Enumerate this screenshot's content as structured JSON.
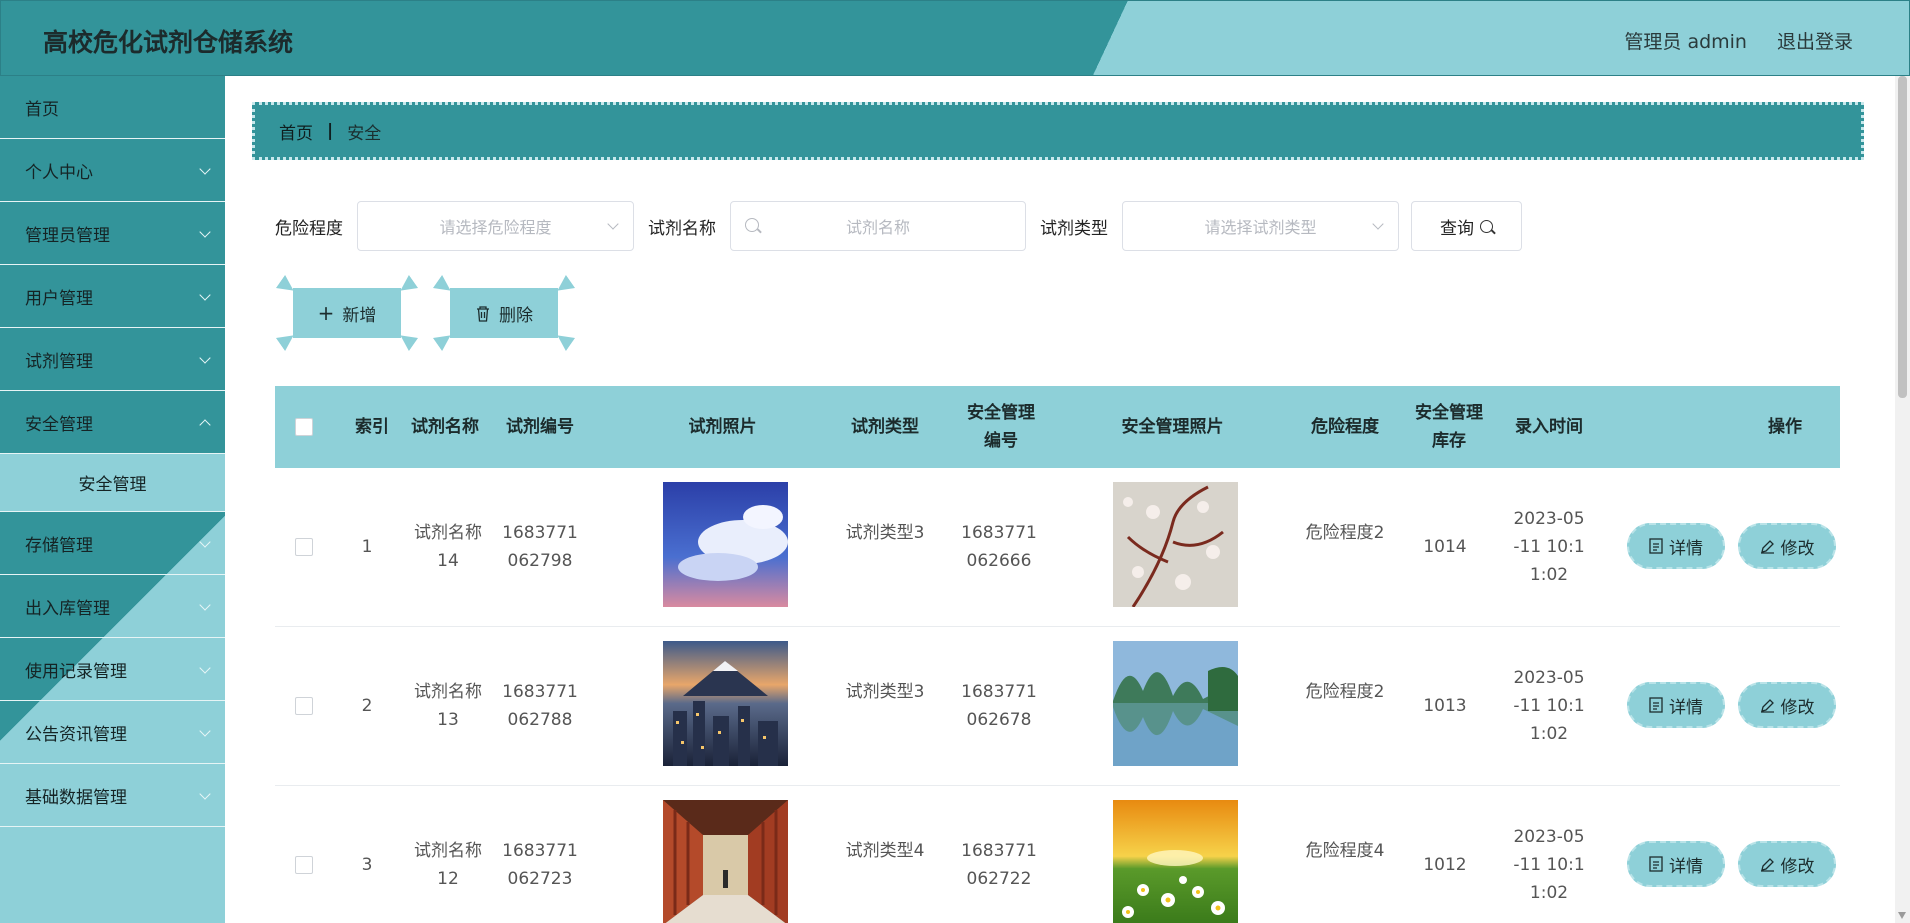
{
  "header": {
    "title": "高校危化试剂仓储系统",
    "user_label": "管理员 admin",
    "logout_label": "退出登录"
  },
  "sidebar": {
    "items": [
      {
        "label": "首页",
        "expandable": false
      },
      {
        "label": "个人中心",
        "expandable": true
      },
      {
        "label": "管理员管理",
        "expandable": true
      },
      {
        "label": "用户管理",
        "expandable": true
      },
      {
        "label": "试剂管理",
        "expandable": true
      },
      {
        "label": "安全管理",
        "expandable": true,
        "open": true,
        "children": [
          "安全管理"
        ]
      },
      {
        "label": "存储管理",
        "expandable": true
      },
      {
        "label": "出入库管理",
        "expandable": true
      },
      {
        "label": "使用记录管理",
        "expandable": true
      },
      {
        "label": "公告资讯管理",
        "expandable": true
      },
      {
        "label": "基础数据管理",
        "expandable": true
      }
    ]
  },
  "breadcrumb": {
    "home": "首页",
    "current": "安全"
  },
  "filters": {
    "danger_label": "危险程度",
    "danger_placeholder": "请选择危险程度",
    "name_label": "试剂名称",
    "name_placeholder": "试剂名称",
    "type_label": "试剂类型",
    "type_placeholder": "请选择试剂类型",
    "query_label": "查询"
  },
  "actions": {
    "add_label": "新增",
    "delete_label": "删除"
  },
  "table": {
    "headers": {
      "index": "索引",
      "name": "试剂名称",
      "code": "试剂编号",
      "photo": "试剂照片",
      "type": "试剂类型",
      "safety_code": "安全管理编号",
      "safety_photo": "安全管理照片",
      "danger": "危险程度",
      "stock": "安全管理库存",
      "time": "录入时间",
      "ops": "操作"
    },
    "row_actions": {
      "detail": "详情",
      "edit": "修改"
    },
    "rows": [
      {
        "index": "1",
        "name": "试剂名称14",
        "code": "1683771062798",
        "type": "试剂类型3",
        "safety_code": "1683771062666",
        "danger": "危险程度2",
        "stock": "1014",
        "time": "2023-05-11 10:11:02",
        "photo": "sky-clouds",
        "safety_photo": "blossom-branch"
      },
      {
        "index": "2",
        "name": "试剂名称13",
        "code": "1683771062788",
        "type": "试剂类型3",
        "safety_code": "1683771062678",
        "danger": "危险程度2",
        "stock": "1013",
        "time": "2023-05-11 10:11:02",
        "photo": "city-mountain",
        "safety_photo": "lake-karst"
      },
      {
        "index": "3",
        "name": "试剂名称12",
        "code": "1683771062723",
        "type": "试剂类型4",
        "safety_code": "1683771062722",
        "danger": "危险程度4",
        "stock": "1012",
        "time": "2023-05-11 10:11:02",
        "photo": "red-corridor",
        "safety_photo": "daisy-sunset"
      }
    ]
  },
  "colors": {
    "primary": "#33949a",
    "accent": "#8ed0d8"
  }
}
